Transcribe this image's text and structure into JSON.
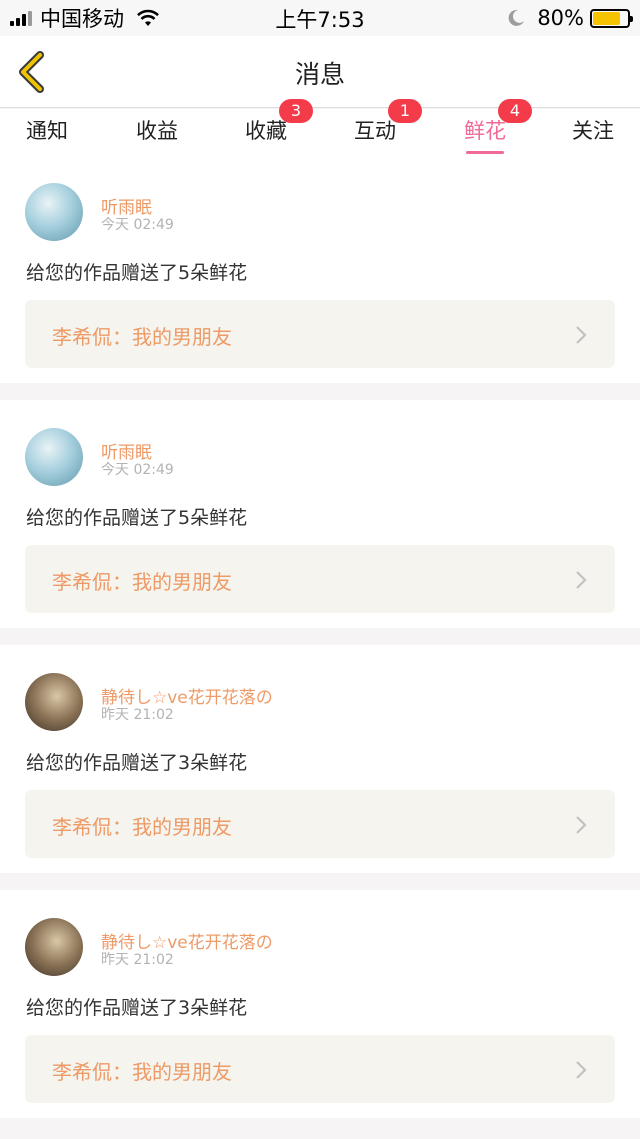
{
  "status_bar": {
    "carrier": "中国移动",
    "time": "上午7:53",
    "battery": "80%",
    "battery_level": 0.8
  },
  "nav": {
    "title": "消息"
  },
  "tabs": [
    {
      "label": "通知",
      "badge": ""
    },
    {
      "label": "收益",
      "badge": ""
    },
    {
      "label": "收藏",
      "badge": "3"
    },
    {
      "label": "互动",
      "badge": "1"
    },
    {
      "label": "鲜花",
      "badge": "4",
      "active": true
    },
    {
      "label": "关注",
      "badge": ""
    }
  ],
  "messages": [
    {
      "user": "听雨眠",
      "time": "今天 02:49",
      "text": "给您的作品赠送了5朵鲜花",
      "work": "李希侃：我的男朋友"
    },
    {
      "user": "听雨眠",
      "time": "今天 02:49",
      "text": "给您的作品赠送了5朵鲜花",
      "work": "李希侃：我的男朋友"
    },
    {
      "user": "静待し☆ve花开花落の",
      "time": "昨天 21:02",
      "text": "给您的作品赠送了3朵鲜花",
      "work": "李希侃：我的男朋友"
    },
    {
      "user": "静待し☆ve花开花落の",
      "time": "昨天 21:02",
      "text": "给您的作品赠送了3朵鲜花",
      "work": "李希侃：我的男朋友"
    }
  ],
  "colors": {
    "accent": "#f06a95",
    "username": "#ee9a66",
    "badge": "#f33b4a",
    "back_arrow": "#f0c500"
  }
}
